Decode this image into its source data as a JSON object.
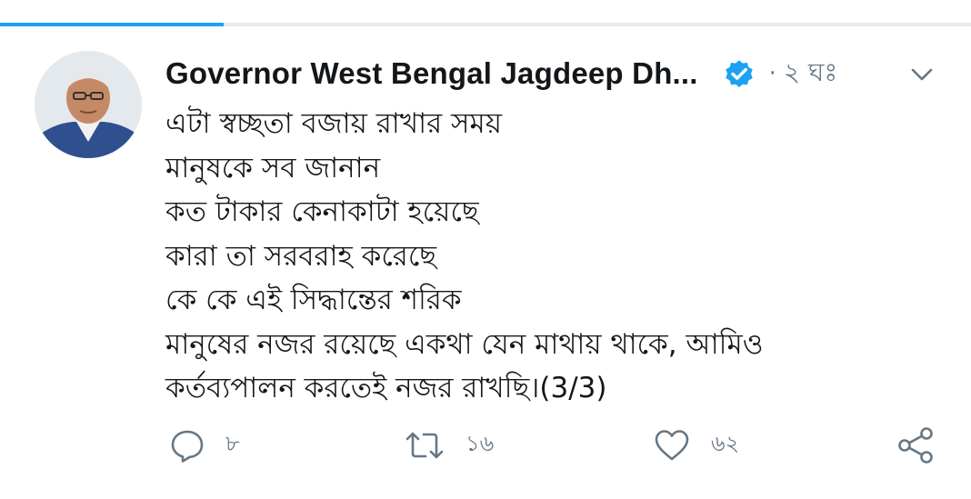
{
  "tweet": {
    "author_name": "Governor West Bengal Jagdeep Dh...",
    "separator": "·",
    "timestamp": "২ ঘঃ",
    "lines": [
      "এটা স্বচ্ছতা বজায় রাখার সময়",
      "মানুষকে সব জানান",
      "কত টাকার কেনাকাটা হয়েছে",
      "কারা তা সরবরাহ করেছে",
      "কে কে এই সিদ্ধান্তের শরিক",
      "মানুষের নজর রয়েছে একথা যেন মাথায় থাকে, আমিও",
      "কর্তব্যপালন করতেই নজর রাখছি।(3/3)"
    ],
    "actions": {
      "reply_count": "৮",
      "retweet_count": "১৬",
      "like_count": "৬২"
    }
  },
  "icons": {
    "verified": "verified-badge-icon",
    "more": "chevron-down-icon",
    "reply": "reply-icon",
    "retweet": "retweet-icon",
    "like": "heart-icon",
    "share": "share-icon"
  },
  "colors": {
    "accent": "#1da1f2",
    "secondary_text": "#657786",
    "primary_text": "#14171a"
  }
}
